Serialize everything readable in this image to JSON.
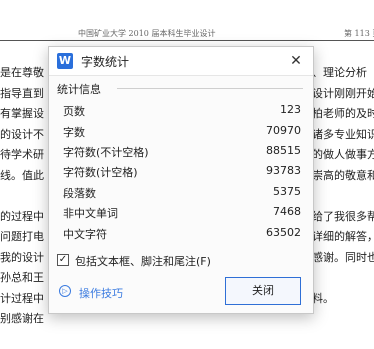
{
  "document": {
    "header_left": "中国矿业大学 2010 届本科生毕业设计",
    "header_right": "第 113 页",
    "left_fragments": [
      "是在尊敬",
      "指导直到",
      "有掌握设",
      "的设计不",
      "待学术研",
      "线。值此",
      "",
      "的过程中",
      "问题打电",
      "我的设计",
      "孙总和王",
      "计过程中",
      "别感谢在"
    ],
    "right_fragments": [
      "、理论分析",
      "设计刚刚开始",
      "柏老师的及时",
      "诸多专业知识",
      "的做人做事方",
      "崇高的敬意和",
      "",
      "给了我很多帮",
      "详细的解答，",
      "感谢。同时也",
      "",
      "料。",
      ""
    ]
  },
  "dialog": {
    "title": "字数统计",
    "app_icon_glyph": "W",
    "app_icon_name": "wps-writer-icon",
    "close_glyph": "✕",
    "group_label": "统计信息",
    "stats": [
      {
        "label": "页数",
        "value": "123"
      },
      {
        "label": "字数",
        "value": "70970"
      },
      {
        "label": "字符数(不计空格)",
        "value": "88515"
      },
      {
        "label": "字符数(计空格)",
        "value": "93783"
      },
      {
        "label": "段落数",
        "value": "5375"
      },
      {
        "label": "非中文单词",
        "value": "7468"
      },
      {
        "label": "中文字符",
        "value": "63502"
      }
    ],
    "checkbox": {
      "label": "包括文本框、脚注和尾注(F)",
      "checked": true,
      "glyph": "✓"
    },
    "tips_label": "操作技巧",
    "tips_glyph": "▷",
    "close_button_label": "关闭"
  }
}
